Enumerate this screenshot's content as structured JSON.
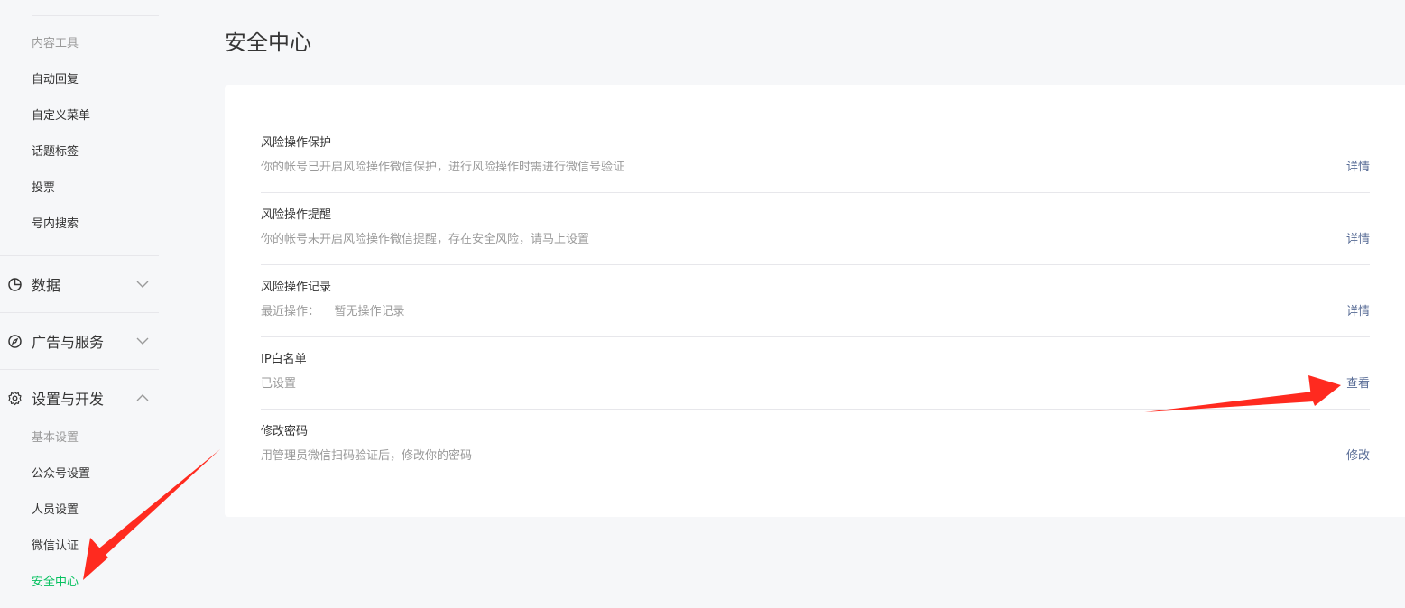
{
  "sidebar": {
    "content_tools": {
      "title": "内容工具",
      "items": [
        {
          "label": "自动回复"
        },
        {
          "label": "自定义菜单"
        },
        {
          "label": "话题标签"
        },
        {
          "label": "投票"
        },
        {
          "label": "号内搜索"
        }
      ]
    },
    "sections": {
      "data": {
        "label": "数据",
        "icon": "pie-chart-icon",
        "expanded": false
      },
      "ads": {
        "label": "广告与服务",
        "icon": "compass-icon",
        "expanded": false
      },
      "settings": {
        "label": "设置与开发",
        "icon": "gear-icon",
        "expanded": true
      }
    },
    "basic_settings": {
      "title": "基本设置",
      "items": [
        {
          "label": "公众号设置"
        },
        {
          "label": "人员设置"
        },
        {
          "label": "微信认证"
        },
        {
          "label": "安全中心",
          "active": true
        }
      ]
    }
  },
  "main": {
    "title": "安全中心",
    "rows": [
      {
        "title": "风险操作保护",
        "desc": "你的帐号已开启风险操作微信保护，进行风险操作时需进行微信号验证",
        "action": "详情"
      },
      {
        "title": "风险操作提醒",
        "desc": "你的帐号未开启风险操作微信提醒，存在安全风险，请马上设置",
        "action": "详情"
      },
      {
        "title": "风险操作记录",
        "desc": "最近操作：    暂无操作记录",
        "action": "详情"
      },
      {
        "title": "IP白名单",
        "desc": "已设置",
        "action": "查看"
      },
      {
        "title": "修改密码",
        "desc": "用管理员微信扫码验证后，修改你的密码",
        "action": "修改"
      }
    ]
  },
  "colors": {
    "active_green": "#07c160",
    "link_blue": "#576b95",
    "annotation_red": "#ff2a1f",
    "background": "#f6f7f9"
  }
}
